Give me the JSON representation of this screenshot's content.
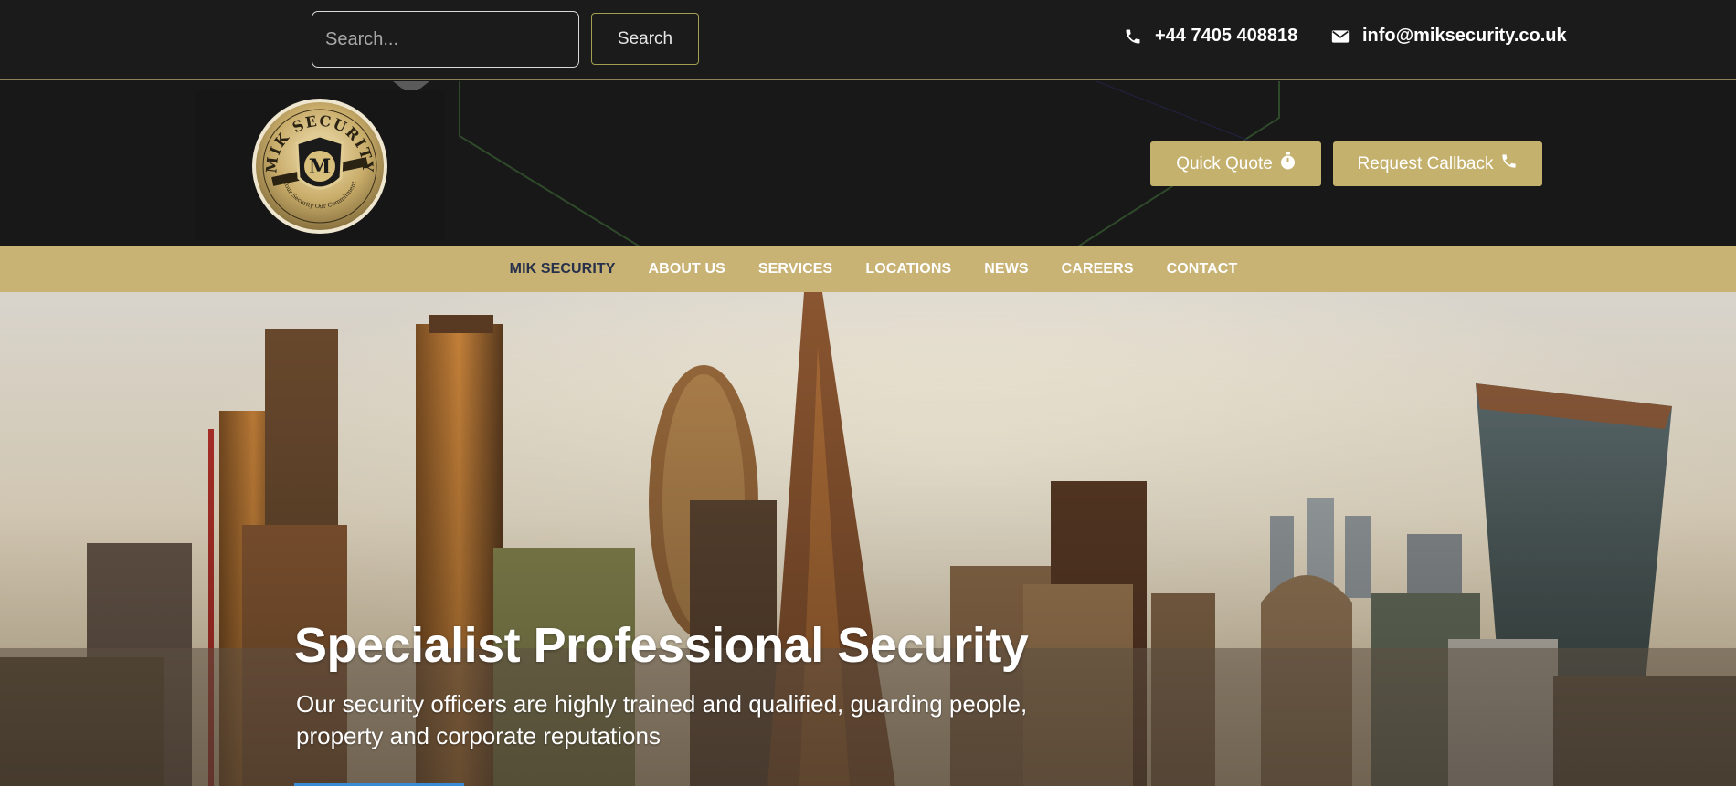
{
  "topbar": {
    "search": {
      "placeholder": "Search...",
      "value": "",
      "button_label": "Search"
    },
    "phone": {
      "icon": "phone-icon",
      "text": "+44 7405 408818"
    },
    "email": {
      "icon": "envelope-icon",
      "text": "info@miksecurity.co.uk"
    }
  },
  "header": {
    "logo": {
      "title": "MIK SECURITY",
      "monogram": "M",
      "tagline": "Your Security Our Commitment"
    },
    "buttons": {
      "quote": {
        "label": "Quick Quote",
        "icon": "stopwatch-icon"
      },
      "callback": {
        "label": "Request Callback",
        "icon": "phone-icon"
      }
    }
  },
  "nav": {
    "items": [
      {
        "label": "MIK SECURITY",
        "active": true
      },
      {
        "label": "ABOUT US"
      },
      {
        "label": "SERVICES"
      },
      {
        "label": "LOCATIONS"
      },
      {
        "label": "NEWS"
      },
      {
        "label": "CAREERS"
      },
      {
        "label": "CONTACT"
      }
    ]
  },
  "hero": {
    "title": "Specialist Professional Security",
    "subtitle": "Our security officers are highly trained and qualified, guarding people, property and corporate reputations"
  },
  "colors": {
    "gold": "#c8b274",
    "button_gold": "#c5b16e",
    "dark": "#181818",
    "nav_active": "#27304a",
    "search_button_border": "#a2a04e"
  }
}
